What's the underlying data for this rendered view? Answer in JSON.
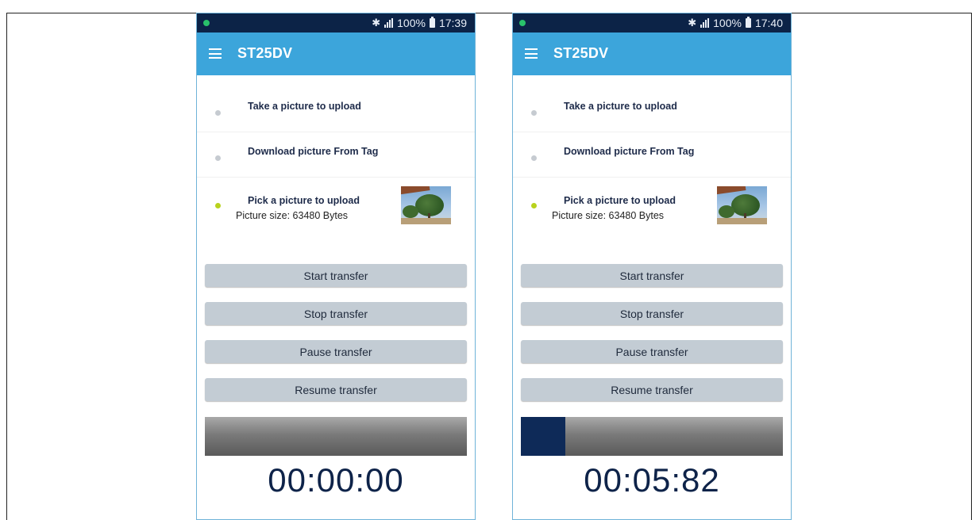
{
  "phones": [
    {
      "status": {
        "battery": "100%",
        "time": "17:39"
      },
      "app_title": "ST25DV",
      "options": [
        {
          "label": "Take a picture to upload",
          "selected": false
        },
        {
          "label": "Download picture From Tag",
          "selected": false
        },
        {
          "label": "Pick a picture to upload",
          "selected": true,
          "detail": "Picture size: 63480 Bytes"
        }
      ],
      "buttons": {
        "start": "Start transfer",
        "stop": "Stop transfer",
        "pause": "Pause transfer",
        "resume": "Resume transfer"
      },
      "progress_fraction": 0.0,
      "timer": "00:00:00"
    },
    {
      "status": {
        "battery": "100%",
        "time": "17:40"
      },
      "app_title": "ST25DV",
      "options": [
        {
          "label": "Take a picture to upload",
          "selected": false
        },
        {
          "label": "Download picture From Tag",
          "selected": false
        },
        {
          "label": "Pick a picture to upload",
          "selected": true,
          "detail": "Picture size: 63480 Bytes"
        }
      ],
      "buttons": {
        "start": "Start transfer",
        "stop": "Stop transfer",
        "pause": "Pause transfer",
        "resume": "Resume transfer"
      },
      "progress_fraction": 0.17,
      "timer": "00:05:82"
    }
  ],
  "colors": {
    "statusbar": "#0c2347",
    "appbar": "#3ca5db",
    "button": "#c3ccd4",
    "progress_fill": "#0e2a58",
    "selected_bullet": "#b9d21d"
  },
  "icons": [
    "menu-icon",
    "bluetooth-icon",
    "signal-icon",
    "battery-icon",
    "notification-dot-icon"
  ]
}
